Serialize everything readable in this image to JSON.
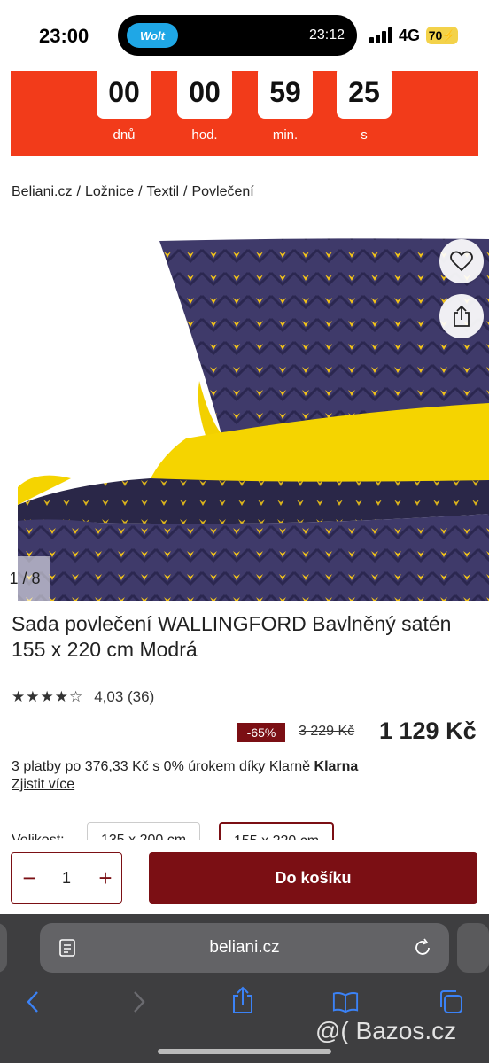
{
  "status_bar": {
    "time": "23:00",
    "island_app": "Wolt",
    "island_time": "23:12",
    "network": "4G",
    "battery": "70"
  },
  "countdown": {
    "units": [
      {
        "value": "00",
        "label": "dnů"
      },
      {
        "value": "00",
        "label": "hod."
      },
      {
        "value": "59",
        "label": "min."
      },
      {
        "value": "25",
        "label": "s"
      }
    ],
    "color": "#f23b1a"
  },
  "breadcrumb": [
    "Beliani.cz",
    "Ložnice",
    "Textil",
    "Povlečení"
  ],
  "gallery": {
    "counter": "1 / 8",
    "wishlist_icon": "heart-icon",
    "share_icon": "share-icon"
  },
  "product": {
    "title": "Sada povlečení WALLINGFORD Bavlněný satén 155 x 220 cm Modrá",
    "rating_value": 4.03,
    "rating_text": "4,03 (36)",
    "stars": "★★★★☆",
    "discount": "-65%",
    "old_price": "3 229 Kč",
    "new_price": "1 129 Kč",
    "klarna_text": "3 platby po 376,33 Kč s 0% úrokem díky Klarně",
    "klarna_brand": "Klarna",
    "klarna_link": "Zjistit více",
    "size_label": "Velikost:",
    "sizes": [
      "135 x 200 cm",
      "155 x 220 cm"
    ],
    "selected_size": "155 x 220 cm"
  },
  "buy_bar": {
    "minus": "−",
    "quantity": "1",
    "plus": "+",
    "cart_label": "Do košíku"
  },
  "browser": {
    "url": "beliani.cz"
  },
  "watermark": "@( Bazos.cz",
  "colors": {
    "brand": "#7b0f14",
    "banner": "#f23b1a",
    "safari_bg": "#3e3e40",
    "accent_blue": "#3b82f6"
  }
}
